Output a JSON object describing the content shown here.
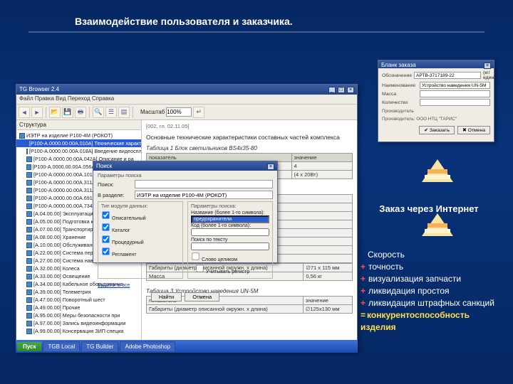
{
  "slide": {
    "title": "Взаимодействие пользователя и заказчика."
  },
  "browser": {
    "title": "TG Browser 2.4",
    "menu": "Файл  Правка  Вид  Переход  Справка",
    "zoom_label": "Масштаб",
    "zoom_value": "100%",
    "crumb": "[002, гл. 02.11.05]",
    "struct_header": "Структура",
    "tree": [
      "ИЭТР на изделие Р100-4М (РОКОТ)",
      "[Р100-А.0000.00.00А.010А] Технические характ…",
      "[Р100-А.0000.00.00А.018А] Введение видеоспл",
      "[Р100-А.0000.00.00А.042А] Описание и ра",
      "[Р100-А.0000.00.00А.056А] Состав комплекса",
      "[Р100-А.0000.00.00А.101А] Установка",
      "[Р100-А.0000.00.00А.311А] Введение",
      "[Р100-А.0000.00.00А.311А] Эксплуатац",
      "[Р100-А.0000.00.00А.691А] Маркировка",
      "[Р100-А.0000.00.00А.734А] Меры безоп",
      "[А.04.00.00] Эксплуатационные огран",
      "[А.05.00.00] Подготовка к работе",
      "[А.07.00.00] Транспортирование",
      "[А.08.00.00] Хранение",
      "[А.10.00.00] Обслуживание",
      "[А.22.00.00] Система передвижения",
      "[А.27.00.00] Система наведения",
      "[А.32.00.00] Колеса",
      "[А.33.00.00] Освещение",
      "[А.34.00.00] Кабельное оборудование",
      "[А.39.00.00] Телеметрия",
      "[А.47.00.00] Поворотный шест",
      "[А.49.00.00] Прочие",
      "[А.95.00.00] Меры безопасности при",
      "[А.97.00.00] Запись видеоинформации",
      "[А.99.00.00] Консервация ЗИП специа"
    ],
    "content": {
      "heading": "Основные технические характеристики составных частей комплекса",
      "t1_caption": "Таблица 1   Блок светильников BS4x35-80",
      "col_name": "показатель",
      "col_val": "значение",
      "t1_rows": [
        [
          "Количество светильников",
          "4"
        ],
        [
          "Мощность",
          "(4 x 20Вт)"
        ]
      ],
      "t2_caption_tail": "окамера TV6-70L4",
      "t2_rows": [
        [
          "",
          "ная с композитным сигналом"
        ],
        [
          "",
          "иде в системе PAL"
        ],
        [
          "",
          "тв линий"
        ],
        [
          "",
          "кс"
        ],
        [
          "",
          "10-оптическое, 4-цифровое)"
        ],
        [
          "",
          "мм до бесконечности"
        ],
        [
          "",
          "одиодный"
        ],
        [
          "",
          "лм"
        ]
      ],
      "t2_bottom": [
        [
          "Габариты (диаметр описанной окружн. x длина)",
          "∅71 x 115 мм"
        ],
        [
          "Масса",
          "0,56 кг"
        ]
      ],
      "t3_caption": "Таблица 3   Устройство наведения UN-5M",
      "t3_rows": [
        [
          "показатель",
          "значение"
        ],
        [
          "Габариты (диаметр описанной окружн. x длина)",
          "∅125x130 мм"
        ]
      ]
    }
  },
  "search": {
    "title": "Поиск",
    "params_label": "Параметры поиска",
    "find_label": "Поиск:",
    "scope_label": "В разделе:",
    "scope_value": "ИЭТР на изделие Р100-4М (РОКОТ)",
    "type_box": "Тип модуля данных:",
    "types": [
      "Описательный",
      "Каталог",
      "Процедурный",
      "Регламент"
    ],
    "params_box": "Параметры поиска:",
    "param_name": "Название (более 1-го символа):",
    "param_name_val": "предохранители",
    "param_code": "Код (более 1-го символа):",
    "text_search": "Поиск по тексту",
    "opt_whole": "Слово целиком",
    "opt_case": "Учитывать регистр",
    "select_all": "Выделить все",
    "btn_find": "Найти",
    "btn_cancel": "Отмена"
  },
  "taskbar": {
    "start": "Пуск",
    "items": [
      "TGB Local",
      "TG Builder",
      "Adobe Photoshop"
    ]
  },
  "orderform": {
    "title": "Бланк заказа",
    "code_label": "Обозначение",
    "code_value": "АРТВ-3717189-22",
    "name_label": "Наименование",
    "name_value": "Устройство наведения UN-5M",
    "mass_label": "Масса",
    "qty_label": "Количество",
    "unit": "(кг/един)",
    "note_label": "Производитель",
    "note_value": "Производитель: ООО НТЦ \"ТАРИС\"",
    "btn_order": "Заказать",
    "btn_cancel": "Отмена"
  },
  "right": {
    "order_heading": "Заказ через Интернет",
    "benefits": [
      "Скорость",
      "точность",
      "визуализация запчасти",
      "ликвидация простоя",
      "ликвидация штрафных санкций"
    ],
    "result": "конкурентоспособность изделия"
  }
}
